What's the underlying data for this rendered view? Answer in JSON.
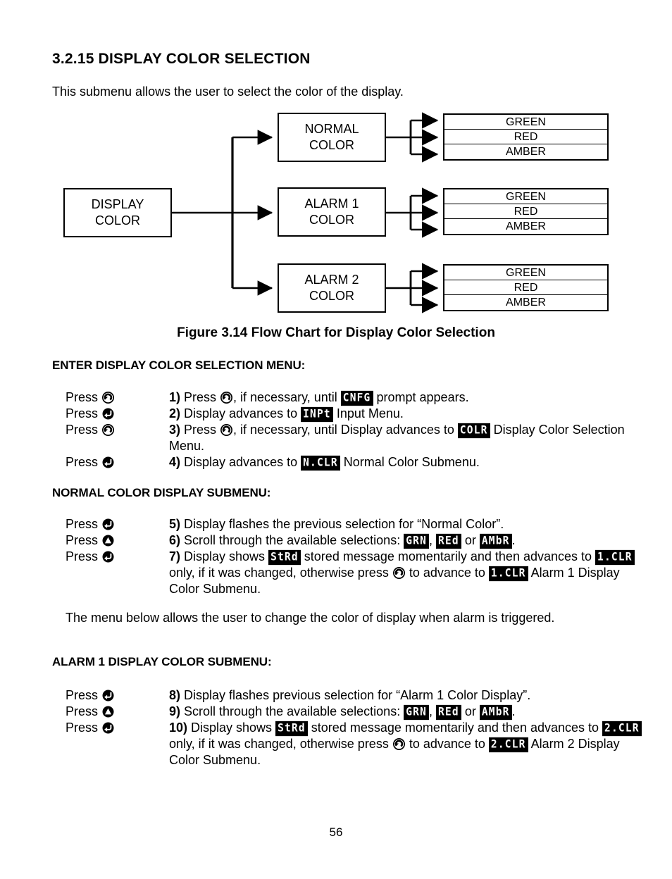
{
  "section": {
    "number": "3.2.15",
    "title": "3.2.15 DISPLAY COLOR SELECTION",
    "intro": "This submenu allows the user to select  the color of the display."
  },
  "figure": {
    "caption": "Figure 3.14 Flow Chart for Display Color Selection",
    "root_box": {
      "line1": "DISPLAY",
      "line2": "COLOR"
    },
    "branches": [
      {
        "box": {
          "line1": "NORMAL",
          "line2": "COLOR"
        },
        "options": [
          "GREEN",
          "RED",
          "AMBER"
        ]
      },
      {
        "box": {
          "line1": "ALARM 1",
          "line2": "COLOR"
        },
        "options": [
          "GREEN",
          "RED",
          "AMBER"
        ]
      },
      {
        "box": {
          "line1": "ALARM 2",
          "line2": "COLOR"
        },
        "options": [
          "GREEN",
          "RED",
          "AMBER"
        ]
      }
    ]
  },
  "sections": {
    "enter_menu_heading": "ENTER DISPLAY COLOR SELECTION MENU:",
    "normal_heading": "NORMAL COLOR DISPLAY SUBMENU:",
    "alarm1_heading": "ALARM 1 DISPLAY COLOR SUBMENU:",
    "mid_paragraph": "The menu below allows the user to change the color of display when alarm is triggered."
  },
  "press_label": "Press",
  "icons": {
    "advance": "circled-arrow-advance-icon",
    "enter": "circled-return-enter-icon",
    "up": "circled-up-arrow-icon"
  },
  "steps": {
    "enter_menu": [
      {
        "press_icon": "advance",
        "num": "1)",
        "parts": [
          {
            "t": "text",
            "v": " Press "
          },
          {
            "t": "icon",
            "v": "advance"
          },
          {
            "t": "text",
            "v": ", if necessary, until "
          },
          {
            "t": "lcd",
            "v": "CNFG"
          },
          {
            "t": "text",
            "v": " prompt appears."
          }
        ]
      },
      {
        "press_icon": "enter",
        "num": "2)",
        "parts": [
          {
            "t": "text",
            "v": " Display advances to "
          },
          {
            "t": "lcd",
            "v": "INPt"
          },
          {
            "t": "text",
            "v": " Input Menu."
          }
        ]
      },
      {
        "press_icon": "advance",
        "num": "3)",
        "parts": [
          {
            "t": "text",
            "v": " Press "
          },
          {
            "t": "icon",
            "v": "advance"
          },
          {
            "t": "text",
            "v": ", if necessary, until Display advances to "
          },
          {
            "t": "lcd",
            "v": "COLR"
          },
          {
            "t": "text",
            "v": " Display Color Selection Menu."
          }
        ]
      },
      {
        "press_icon": "enter",
        "num": "4)",
        "parts": [
          {
            "t": "text",
            "v": " Display advances to "
          },
          {
            "t": "lcd",
            "v": "N.CLR"
          },
          {
            "t": "text",
            "v": " Normal Color Submenu."
          }
        ]
      }
    ],
    "normal_color": [
      {
        "press_icon": "enter",
        "num": "5)",
        "parts": [
          {
            "t": "text",
            "v": " Display flashes the previous selection for “Normal Color”."
          }
        ]
      },
      {
        "press_icon": "up",
        "num": "6)",
        "parts": [
          {
            "t": "text",
            "v": " Scroll through the available selections: "
          },
          {
            "t": "lcd",
            "v": "GRN"
          },
          {
            "t": "text",
            "v": ", "
          },
          {
            "t": "lcd",
            "v": "REd"
          },
          {
            "t": "text",
            "v": " or "
          },
          {
            "t": "lcd",
            "v": "AMbR"
          },
          {
            "t": "text",
            "v": "."
          }
        ]
      },
      {
        "press_icon": "enter",
        "num": "7)",
        "parts": [
          {
            "t": "text",
            "v": " Display shows "
          },
          {
            "t": "lcd",
            "v": "StRd"
          },
          {
            "t": "text",
            "v": " stored message momentarily and then advances to "
          },
          {
            "t": "lcd",
            "v": "1.CLR"
          },
          {
            "t": "text",
            "v": " only, if it was changed, otherwise press "
          },
          {
            "t": "icon",
            "v": "advance"
          },
          {
            "t": "text",
            "v": " to advance to "
          },
          {
            "t": "lcd",
            "v": "1.CLR"
          },
          {
            "t": "text",
            "v": " Alarm 1 Display Color Submenu."
          }
        ]
      }
    ],
    "alarm1_color": [
      {
        "press_icon": "enter",
        "num": "8)",
        "parts": [
          {
            "t": "text",
            "v": " Display flashes previous selection for “Alarm 1 Color Display”."
          }
        ]
      },
      {
        "press_icon": "up",
        "num": "9)",
        "parts": [
          {
            "t": "text",
            "v": " Scroll through the available selections: "
          },
          {
            "t": "lcd",
            "v": "GRN"
          },
          {
            "t": "text",
            "v": ", "
          },
          {
            "t": "lcd",
            "v": "REd"
          },
          {
            "t": "text",
            "v": " or "
          },
          {
            "t": "lcd",
            "v": "AMbR"
          },
          {
            "t": "text",
            "v": "."
          }
        ]
      },
      {
        "press_icon": "enter",
        "num": "10)",
        "parts": [
          {
            "t": "text",
            "v": " Display shows "
          },
          {
            "t": "lcd",
            "v": "StRd"
          },
          {
            "t": "text",
            "v": " stored message momentarily and then advances to "
          },
          {
            "t": "lcd",
            "v": "2.CLR"
          },
          {
            "t": "text",
            "v": " only, if it was changed, otherwise press "
          },
          {
            "t": "icon",
            "v": "advance"
          },
          {
            "t": "text",
            "v": " to advance to "
          },
          {
            "t": "lcd",
            "v": "2.CLR"
          },
          {
            "t": "text",
            "v": " Alarm 2 Display Color Submenu."
          }
        ]
      }
    ]
  },
  "footer": {
    "page_number": "56"
  },
  "colors": {
    "ink": "#000000",
    "paper": "#ffffff"
  }
}
